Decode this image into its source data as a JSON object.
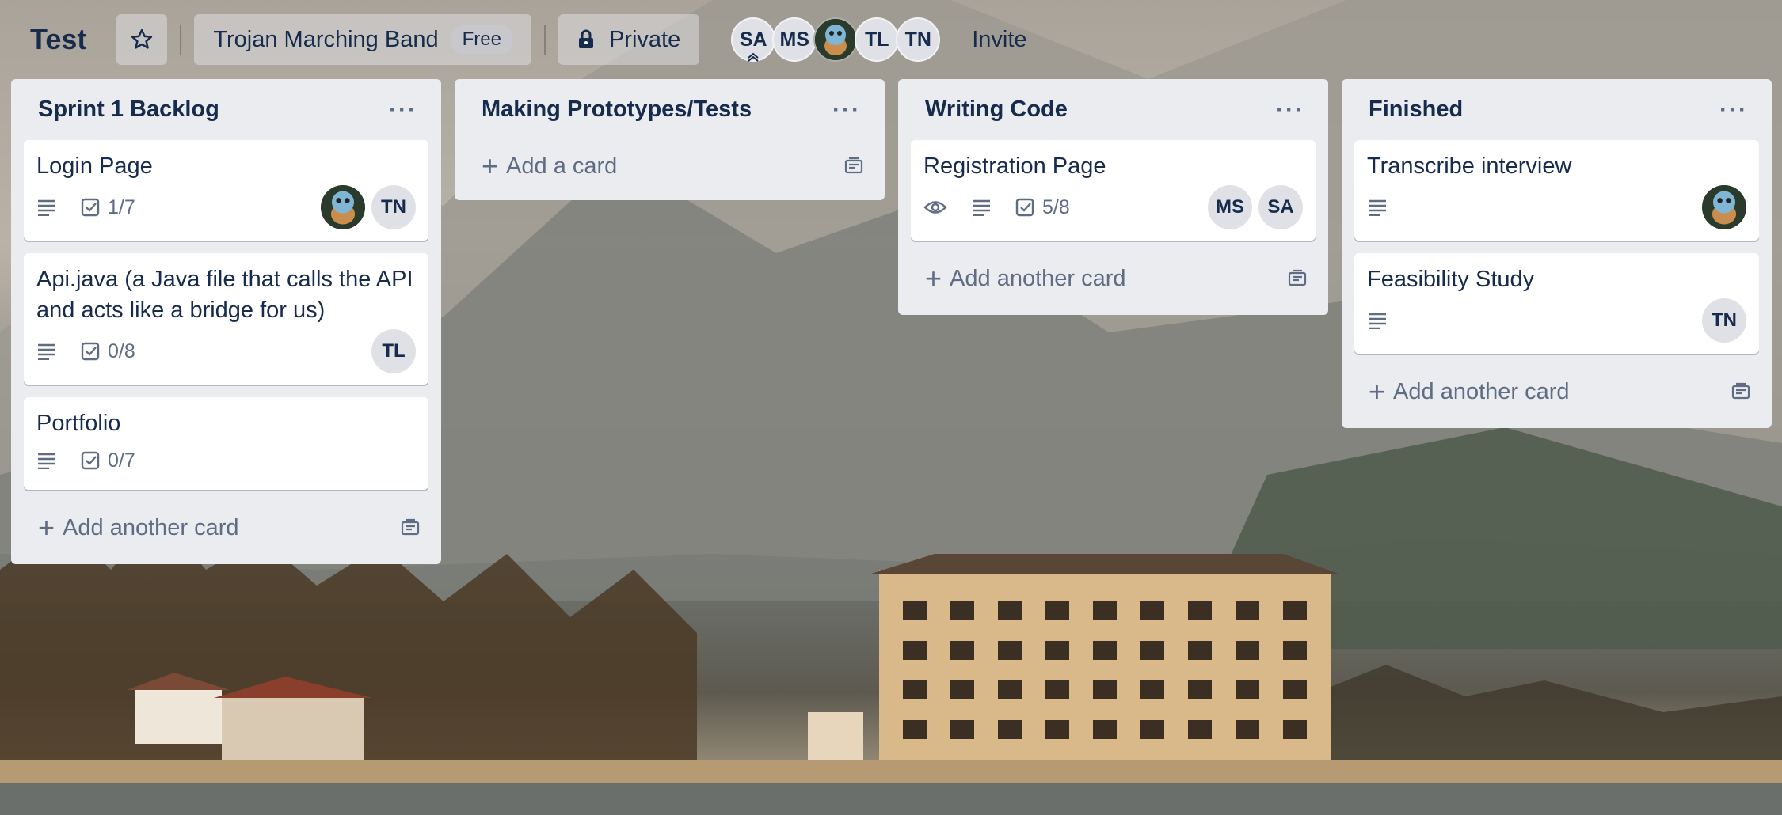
{
  "header": {
    "board_title": "Test",
    "team_name": "Trojan Marching Band",
    "plan_badge": "Free",
    "visibility": "Private",
    "members": [
      "SA",
      "MS",
      "TL",
      "TN"
    ],
    "invite_label": "Invite"
  },
  "lists": [
    {
      "title": "Sprint 1 Backlog",
      "add_label": "Add another card",
      "cards": [
        {
          "title": "Login Page",
          "checklist": "1/7",
          "members": [
            "TN"
          ]
        },
        {
          "title": "Api.java (a Java file that calls the API and acts like a bridge for us)",
          "checklist": "0/8",
          "members": [
            "TL"
          ]
        },
        {
          "title": "Portfolio",
          "checklist": "0/7"
        }
      ]
    },
    {
      "title": "Making Prototypes/Tests",
      "add_label": "Add a card",
      "cards": []
    },
    {
      "title": "Writing Code",
      "add_label": "Add another card",
      "cards": [
        {
          "title": "Registration Page",
          "checklist": "5/8",
          "members": [
            "MS",
            "SA"
          ]
        }
      ]
    },
    {
      "title": "Finished",
      "add_label": "Add another card",
      "cards": [
        {
          "title": "Transcribe interview"
        },
        {
          "title": "Feasibility Study",
          "members": [
            "TN"
          ]
        }
      ]
    }
  ],
  "colors": {
    "list_bg": "#ebecf0",
    "text": "#172b4d",
    "muted": "#5e6c84"
  }
}
